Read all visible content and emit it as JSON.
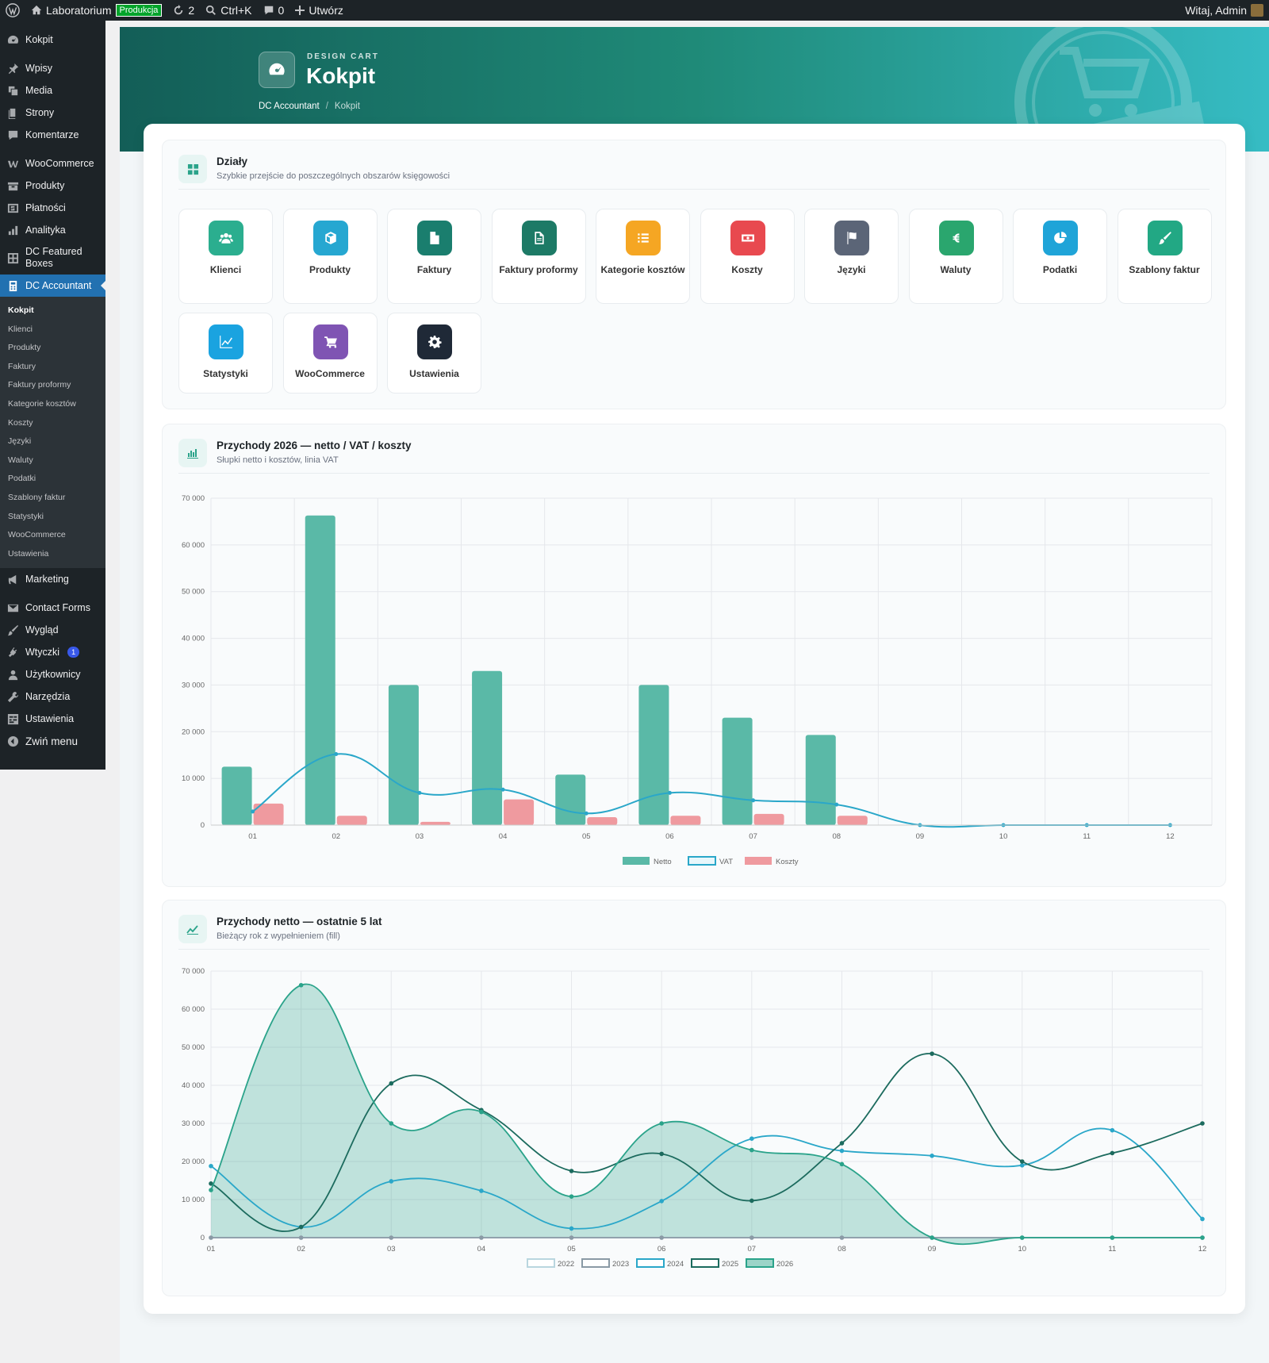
{
  "adminbar": {
    "site_name": "Laboratorium",
    "env_badge": "Produkcja",
    "updates_count": "2",
    "search_shortcut": "Ctrl+K",
    "comments_count": "0",
    "new_label": "Utwórz",
    "greeting": "Witaj, Admin"
  },
  "sidebar": {
    "dashboard": "Kokpit",
    "posts": "Wpisy",
    "media": "Media",
    "pages": "Strony",
    "comments": "Komentarze",
    "woocommerce": "WooCommerce",
    "products": "Produkty",
    "payments": "Płatności",
    "analytics": "Analityka",
    "featured_boxes": "DC Featured Boxes",
    "accountant": "DC Accountant",
    "submenu": [
      "Kokpit",
      "Klienci",
      "Produkty",
      "Faktury",
      "Faktury proformy",
      "Kategorie kosztów",
      "Koszty",
      "Języki",
      "Waluty",
      "Podatki",
      "Szablony faktur",
      "Statystyki",
      "WooCommerce",
      "Ustawienia"
    ],
    "marketing": "Marketing",
    "contact_forms": "Contact Forms",
    "appearance": "Wygląd",
    "plugins": "Wtyczki",
    "plugins_badge": "1",
    "users": "Użytkownicy",
    "tools": "Narzędzia",
    "settings": "Ustawienia",
    "collapse": "Zwiń menu"
  },
  "hero": {
    "eyebrow": "DESIGN CART",
    "title": "Kokpit",
    "breadcrumb_root": "DC Accountant",
    "breadcrumb_sep": "/",
    "breadcrumb_current": "Kokpit"
  },
  "sections": {
    "title": "Działy",
    "subtitle": "Szybkie przejście do poszczególnych obszarów księgowości",
    "tiles": [
      {
        "label": "Klienci",
        "color": "#2bae8f",
        "icon": "users-icon"
      },
      {
        "label": "Produkty",
        "color": "#26a7d1",
        "icon": "box-icon"
      },
      {
        "label": "Faktury",
        "color": "#1a7e6e",
        "icon": "document-icon"
      },
      {
        "label": "Faktury proformy",
        "color": "#1d7a66",
        "icon": "document-outline-icon"
      },
      {
        "label": "Kategorie kosztów",
        "color": "#f5a623",
        "icon": "list-icon"
      },
      {
        "label": "Koszty",
        "color": "#e8494f",
        "icon": "money-icon"
      },
      {
        "label": "Języki",
        "color": "#5b6577",
        "icon": "flag-icon"
      },
      {
        "label": "Waluty",
        "color": "#2aa66e",
        "icon": "euro-icon"
      },
      {
        "label": "Podatki",
        "color": "#1fa4d8",
        "icon": "pie-chart-icon"
      },
      {
        "label": "Szablony faktur",
        "color": "#22a884",
        "icon": "brush-icon"
      },
      {
        "label": "Statystyki",
        "color": "#1aa3e0",
        "icon": "line-chart-icon"
      },
      {
        "label": "WooCommerce",
        "color": "#7f54b3",
        "icon": "cart-icon"
      },
      {
        "label": "Ustawienia",
        "color": "#1f2937",
        "icon": "gear-icon"
      }
    ]
  },
  "chart1": {
    "title": "Przychody 2026 — netto / VAT / koszty",
    "subtitle": "Słupki netto i kosztów, linia VAT"
  },
  "chart2": {
    "title": "Przychody netto — ostatnie 5 lat",
    "subtitle": "Bieżący rok z wypełnieniem (fill)"
  },
  "chart_data": [
    {
      "type": "bar",
      "categories": [
        "01",
        "02",
        "03",
        "04",
        "05",
        "06",
        "07",
        "08",
        "09",
        "10",
        "11",
        "12"
      ],
      "ylim": [
        0,
        70000
      ],
      "yticks": [
        0,
        10000,
        20000,
        30000,
        40000,
        50000,
        60000,
        70000
      ],
      "ytick_labels": [
        "0",
        "10 000",
        "20 000",
        "30 000",
        "40 000",
        "50 000",
        "60 000",
        "70 000"
      ],
      "grid": true,
      "legend": "bottom",
      "series": [
        {
          "name": "Netto",
          "kind": "bar",
          "color": "#5ab9a7",
          "values": [
            12500,
            66300,
            30000,
            33000,
            10800,
            30000,
            23000,
            19300,
            0,
            0,
            0,
            0
          ]
        },
        {
          "name": "VAT",
          "kind": "line",
          "color": "#2aa7c9",
          "values": [
            2900,
            15200,
            6900,
            7600,
            2500,
            6900,
            5300,
            4400,
            0,
            0,
            0,
            0
          ]
        },
        {
          "name": "Koszty",
          "kind": "bar",
          "color": "#ef9a9f",
          "values": [
            4600,
            2000,
            700,
            5500,
            1700,
            2000,
            2400,
            2000,
            0,
            0,
            0,
            0
          ]
        }
      ]
    },
    {
      "type": "line",
      "categories": [
        "01",
        "02",
        "03",
        "04",
        "05",
        "06",
        "07",
        "08",
        "09",
        "10",
        "11",
        "12"
      ],
      "ylim": [
        0,
        70000
      ],
      "yticks": [
        0,
        10000,
        20000,
        30000,
        40000,
        50000,
        60000,
        70000
      ],
      "ytick_labels": [
        "0",
        "10 000",
        "20 000",
        "30 000",
        "40 000",
        "50 000",
        "60 000",
        "70 000"
      ],
      "grid": true,
      "legend": "bottom",
      "series": [
        {
          "name": "2022",
          "color": "#b9d6df",
          "fill": false,
          "values": [
            0,
            0,
            0,
            0,
            0,
            0,
            0,
            0,
            0,
            0,
            0,
            0
          ]
        },
        {
          "name": "2023",
          "color": "#8a9aa5",
          "fill": false,
          "values": [
            0,
            0,
            0,
            0,
            0,
            0,
            0,
            0,
            0,
            0,
            0,
            0
          ]
        },
        {
          "name": "2024",
          "color": "#2aa7c9",
          "fill": false,
          "values": [
            18800,
            2800,
            14800,
            12300,
            2400,
            9600,
            26000,
            22800,
            21500,
            19000,
            28200,
            4900
          ]
        },
        {
          "name": "2025",
          "color": "#1c6b5e",
          "fill": false,
          "values": [
            14200,
            2800,
            40500,
            33500,
            17500,
            22000,
            9700,
            24800,
            48300,
            20000,
            22200,
            30000
          ]
        },
        {
          "name": "2026",
          "color": "#2aa38a",
          "fill": true,
          "values": [
            12500,
            66300,
            30000,
            33000,
            10800,
            30000,
            23000,
            19300,
            0,
            0,
            0,
            0
          ]
        }
      ]
    }
  ]
}
